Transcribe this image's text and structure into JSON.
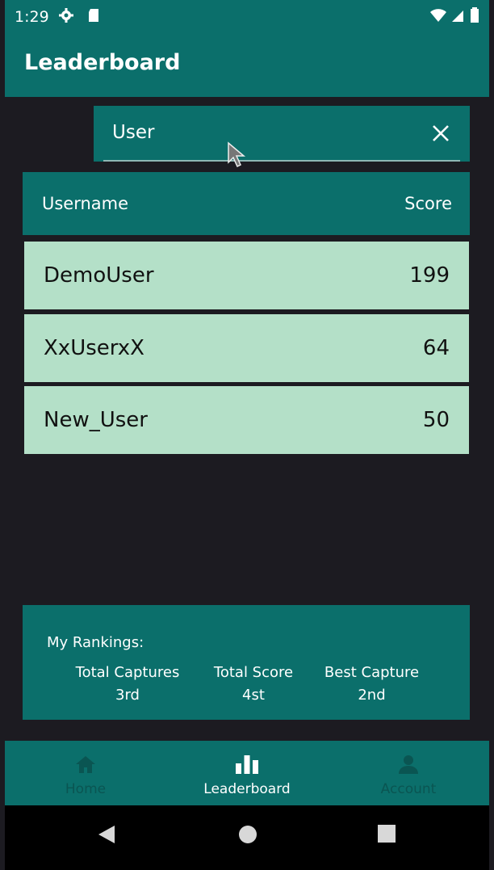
{
  "status_bar": {
    "time": "1:29"
  },
  "app_bar": {
    "title": "Leaderboard"
  },
  "search": {
    "value": "User"
  },
  "table": {
    "headers": {
      "username": "Username",
      "score": "Score"
    },
    "rows": [
      {
        "username": "DemoUser",
        "score": "199"
      },
      {
        "username": "XxUserxX",
        "score": "64"
      },
      {
        "username": "New_User",
        "score": "50"
      }
    ]
  },
  "rankings": {
    "heading": "My Rankings:",
    "items": [
      {
        "label": "Total Captures",
        "value": "3rd"
      },
      {
        "label": "Total Score",
        "value": "4st"
      },
      {
        "label": "Best Capture",
        "value": "2nd"
      }
    ]
  },
  "bottom_nav": {
    "items": [
      {
        "label": "Home",
        "icon": "home-icon"
      },
      {
        "label": "Leaderboard",
        "icon": "leaderboard-icon",
        "selected": true
      },
      {
        "label": "Account",
        "icon": "account-icon"
      }
    ]
  },
  "colors": {
    "primary": "#0b6f6b",
    "row_bg": "#b4e0c8",
    "background": "#1c1b21",
    "nav_inactive": "#0a5552"
  }
}
